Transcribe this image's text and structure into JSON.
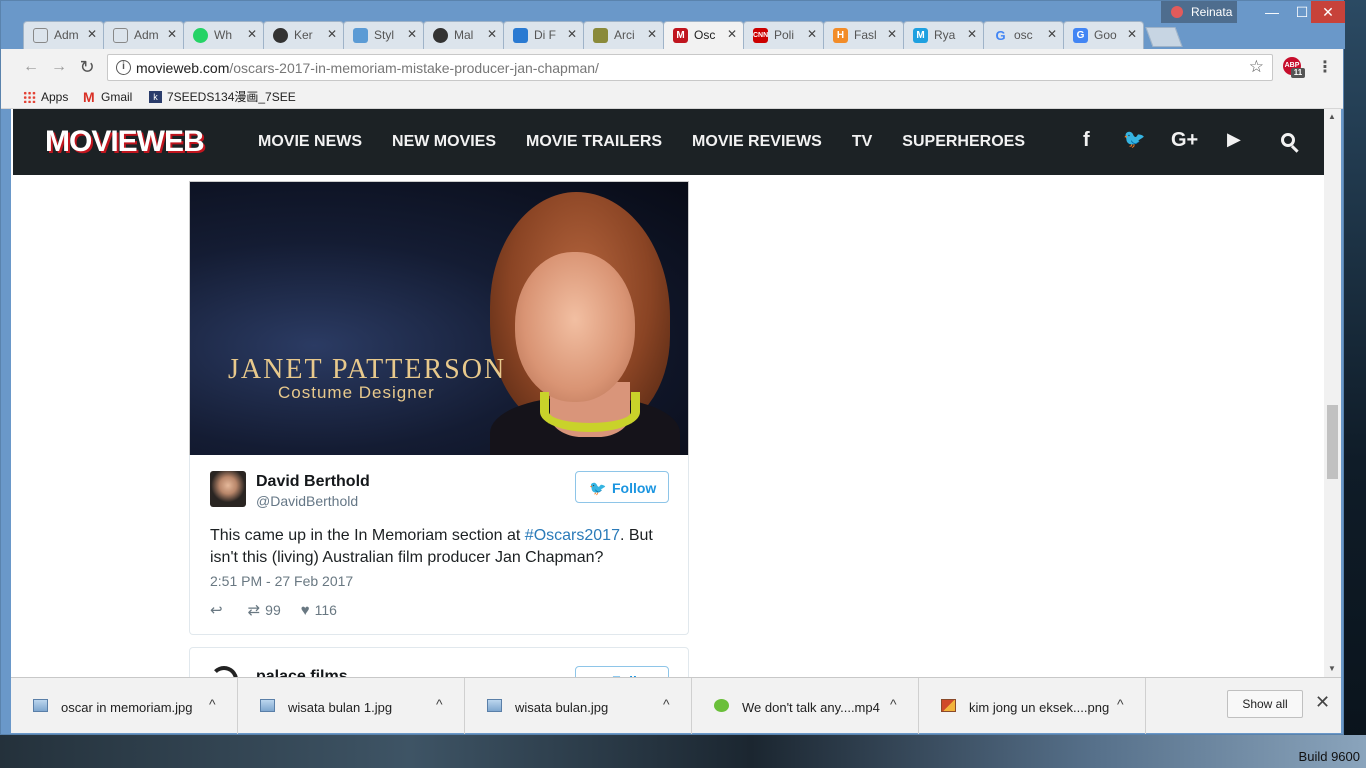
{
  "window": {
    "profile_name": "Reinata",
    "minimize": "—",
    "maximize": "☐",
    "close": "✕"
  },
  "tabs": [
    {
      "label": "Adm",
      "favicon": "page-icon",
      "color": "#888888"
    },
    {
      "label": "Adm",
      "favicon": "page-icon",
      "color": "#888888"
    },
    {
      "label": "Wh",
      "favicon": "whatsapp-icon",
      "color": "#25d366"
    },
    {
      "label": "Ker",
      "favicon": "github-icon",
      "color": "#333333"
    },
    {
      "label": "Styl",
      "favicon": "dm-icon",
      "color": "#5b9bd5"
    },
    {
      "label": "Mal",
      "favicon": "github-icon",
      "color": "#333333"
    },
    {
      "label": "Di F",
      "favicon": "walker-icon",
      "color": "#2a7ad2"
    },
    {
      "label": "Arci",
      "favicon": "sr-icon",
      "color": "#8a8a3a"
    },
    {
      "label": "Osc",
      "favicon": "movieweb-icon",
      "color": "#c0151e",
      "active": true
    },
    {
      "label": "Poli",
      "favicon": "cnn-icon",
      "color": "#cc0000"
    },
    {
      "label": "Fasl",
      "favicon": "hk-icon",
      "color": "#f28c28"
    },
    {
      "label": "Rya",
      "favicon": "m-icon",
      "color": "#1ea0e0"
    },
    {
      "label": "osc",
      "favicon": "google-icon",
      "color": "#4285f4"
    },
    {
      "label": "Goo",
      "favicon": "translate-icon",
      "color": "#4285f4"
    }
  ],
  "toolbar": {
    "back": "←",
    "forward": "→",
    "reload": "↻",
    "url_domain": "movieweb.com",
    "url_path": "/oscars-2017-in-memoriam-mistake-producer-jan-chapman/",
    "star": "☆",
    "abp_label": "ABP",
    "abp_count": "11",
    "menu": "⋮"
  },
  "bookmarks": [
    {
      "label": "Apps",
      "icon": "apps-icon"
    },
    {
      "label": "Gmail",
      "icon": "gmail-icon"
    },
    {
      "label": "7SEEDS134漫画_7SEE",
      "icon": "bookmark-icon"
    }
  ],
  "site": {
    "logo": "MOVIEWEB",
    "nav": [
      "MOVIE NEWS",
      "NEW MOVIES",
      "MOVIE TRAILERS",
      "MOVIE REVIEWS",
      "TV",
      "SUPERHEROES"
    ],
    "social": [
      "f",
      "🐦",
      "G+",
      "▶"
    ]
  },
  "tweet": {
    "photo_caption_name": "JANET PATTERSON",
    "photo_caption_role": "Costume Designer",
    "author": "David Berthold",
    "handle": "@DavidBerthold",
    "follow_label": "Follow",
    "text_before": "This came up in the In Memoriam section at ",
    "hashtag": "#Oscars2017",
    "text_after": ". But isn't this (living) Australian film producer Jan Chapman?",
    "timestamp": "2:51 PM - 27 Feb 2017",
    "retweets": "99",
    "likes": "116"
  },
  "tweet2": {
    "author": "palace films",
    "follow_label": "Follow"
  },
  "downloads": {
    "items": [
      {
        "name": "oscar in memoriam.jpg",
        "icon": "image-file-icon"
      },
      {
        "name": "wisata bulan 1.jpg",
        "icon": "image-file-icon"
      },
      {
        "name": "wisata bulan.jpg",
        "icon": "image-file-icon"
      },
      {
        "name": "We don't talk any....mp4",
        "icon": "video-file-icon"
      },
      {
        "name": "kim jong un eksek....png",
        "icon": "png-file-icon"
      }
    ],
    "show_all": "Show all",
    "close": "✕"
  },
  "desktop": {
    "build_label": "Build 9600"
  }
}
